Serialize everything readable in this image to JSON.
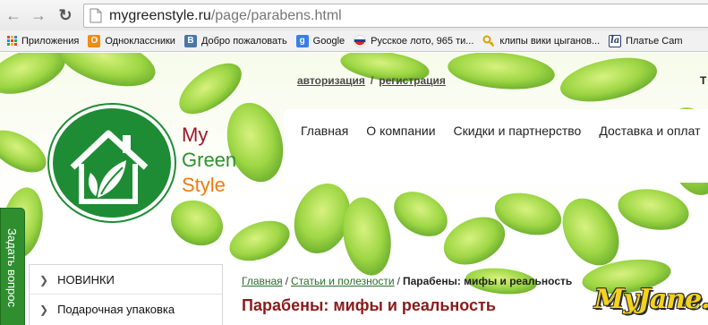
{
  "browser": {
    "url_domain": "mygreenstyle.ru",
    "url_path": "/page/parabens.html",
    "bookmarks": [
      {
        "label": "Приложения",
        "icon": "apps-icon"
      },
      {
        "label": "Одноклассники",
        "icon": "odnoklassniki-icon",
        "color": "#f28b14"
      },
      {
        "label": "Добро пожаловать",
        "icon": "vk-icon",
        "color": "#4a76a8"
      },
      {
        "label": "Google",
        "icon": "google-icon",
        "color": "#3a7ee8"
      },
      {
        "label": "Русское лото, 965 ти...",
        "icon": "russian-flag-icon"
      },
      {
        "label": "клипы вики цыганов...",
        "icon": "key-icon"
      },
      {
        "label": "Платье Cam",
        "icon": "la-icon"
      }
    ]
  },
  "site": {
    "auth": {
      "login": "авторизация",
      "separator": "/",
      "register": "регистрация"
    },
    "top_right_letter": "Т",
    "logo": {
      "line1": "My",
      "line2": "Green",
      "line3": "Style"
    },
    "menu": [
      "Главная",
      "О компании",
      "Скидки и партнерство",
      "Доставка и оплат"
    ],
    "side_tab": "Задать вопрос",
    "sidebar": [
      "НОВИНКИ",
      "Подарочная упаковка"
    ],
    "breadcrumb": {
      "home": "Главная",
      "section": "Статьи и полезности",
      "sep": "/",
      "current": "Парабены: мифы и реальность"
    },
    "title": "Парабены: мифы и реальность",
    "watermark": "MyJane.ru"
  },
  "colors": {
    "brand_green": "#2f8f2f",
    "brand_red": "#a0162a",
    "brand_orange": "#f07a12",
    "title_color": "#8b1a1a",
    "leaf_green": "#8fd43a"
  }
}
